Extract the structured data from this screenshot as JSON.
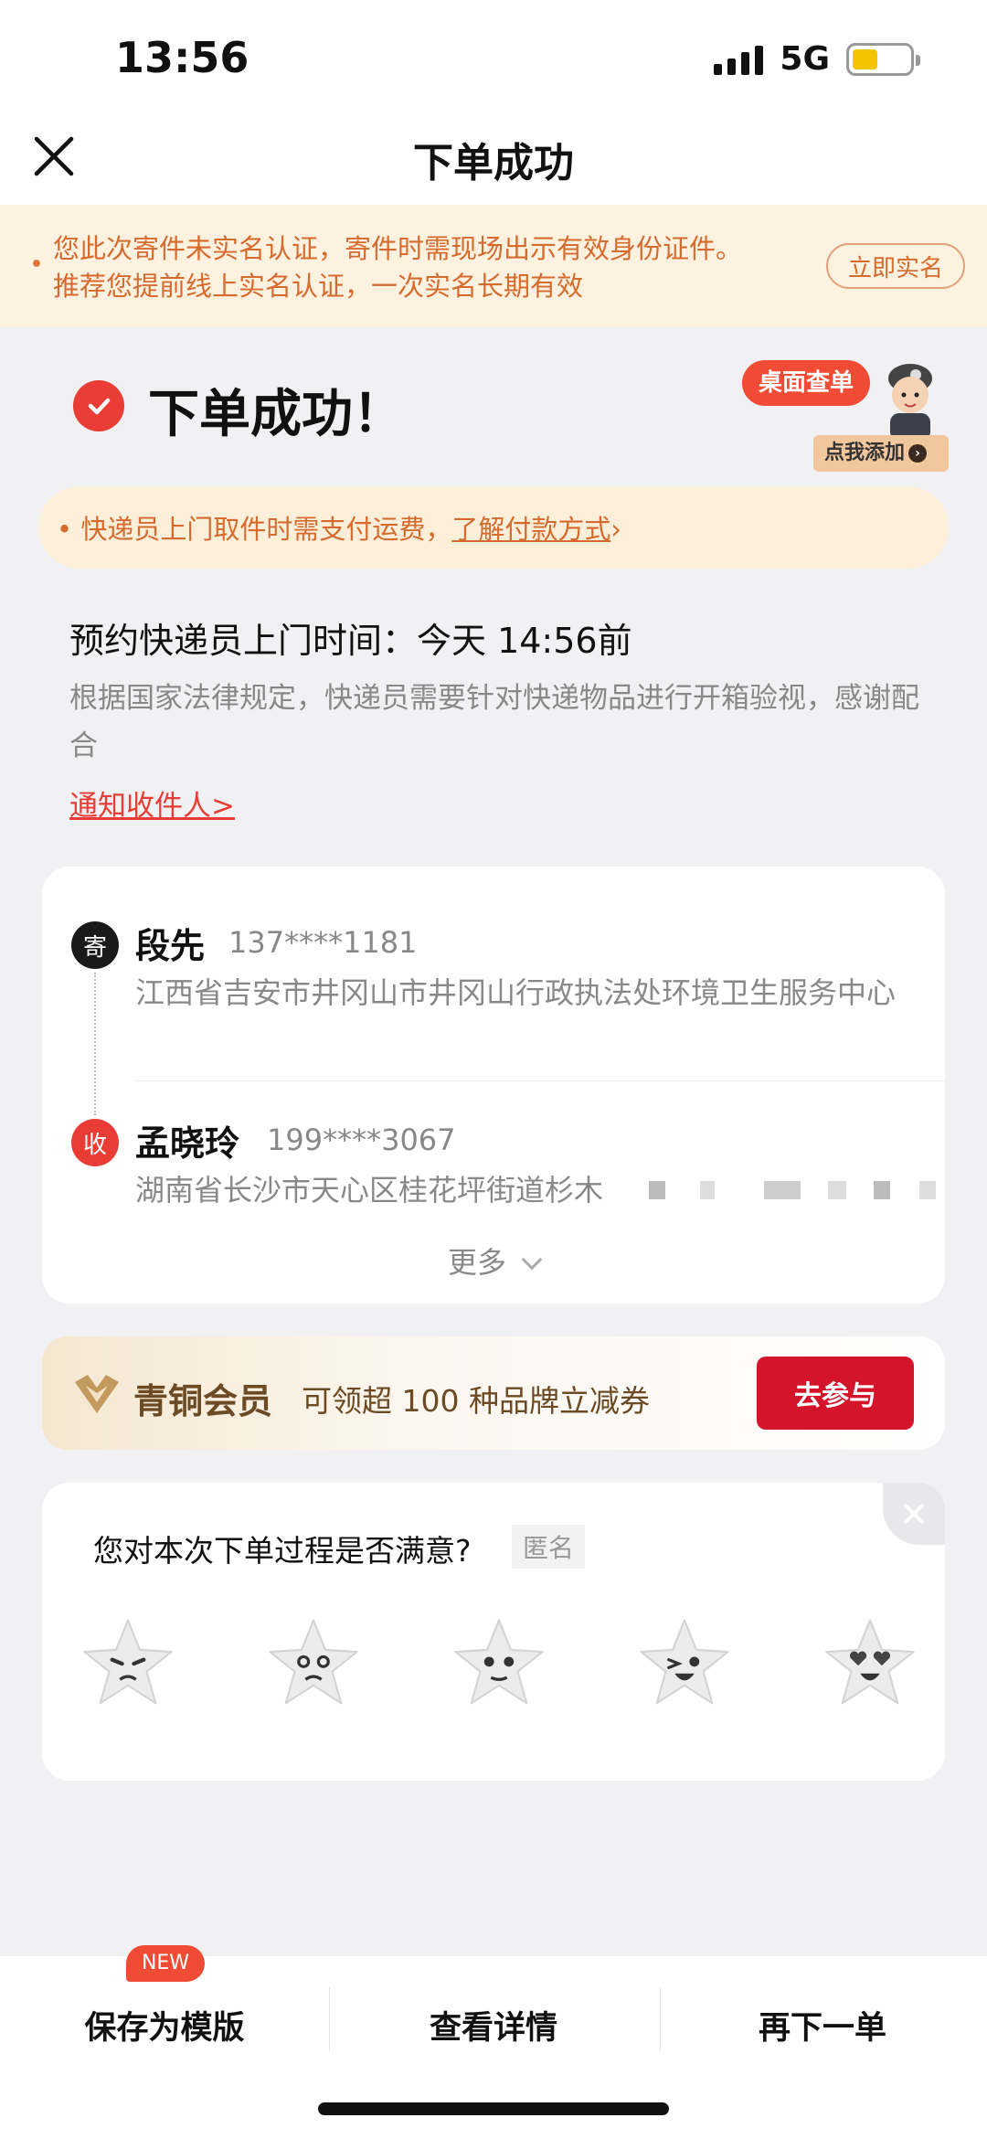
{
  "status_bar": {
    "time": "13:56",
    "network": "5G",
    "battery_level": 0.45
  },
  "nav": {
    "title": "下单成功"
  },
  "notice": {
    "line1": "您此次寄件未实名认证，寄件时需现场出示有效身份证件。",
    "line2": "推荐您提前线上实名认证，一次实名长期有效",
    "button": "立即实名"
  },
  "success": {
    "title": "下单成功！"
  },
  "widget": {
    "bubble": "桌面查单",
    "add_label": "点我添加"
  },
  "payment_notice": {
    "prefix": "• 快递员上门取件时需支付运费，",
    "link": "了解付款方式",
    "link_arrow": "›"
  },
  "appointment": {
    "line": "预约快递员上门时间：今天 14:56前",
    "law": "根据国家法律规定，快递员需要针对快递物品进行开箱验视，感谢配合",
    "notify_link": "通知收件人>"
  },
  "sender": {
    "tag": "寄",
    "name": "段先",
    "phone": "137****1181",
    "address": "江西省吉安市井冈山市井冈山行政执法处环境卫生服务中心"
  },
  "receiver": {
    "tag": "收",
    "name": "孟晓玲",
    "phone": "199****3067",
    "address": "湖南省长沙市天心区桂花坪街道杉木"
  },
  "address_card": {
    "more": "更多"
  },
  "member": {
    "title": "青铜会员",
    "desc": "可领超 100 种品牌立减券",
    "button": "去参与"
  },
  "survey": {
    "question": "您对本次下单过程是否满意?",
    "anonymous": "匿名"
  },
  "bottom_bar": {
    "save_template": "保存为模版",
    "new_badge": "NEW",
    "view_details": "查看详情",
    "reorder": "再下一单"
  },
  "colors": {
    "accent_red": "#e83c35",
    "notice_orange": "#d56b2e",
    "member_brown": "#6b4a24",
    "join_red": "#d4142a"
  }
}
